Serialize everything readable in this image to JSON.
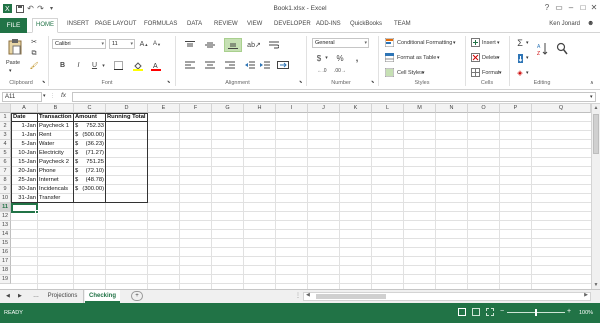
{
  "window": {
    "title": "Book1.xlsx - Excel",
    "user": "Ken Jonard"
  },
  "ribbon_tabs": [
    "FILE",
    "HOME",
    "INSERT",
    "PAGE LAYOUT",
    "FORMULAS",
    "DATA",
    "REVIEW",
    "VIEW",
    "DEVELOPER",
    "ADD-INS",
    "QuickBooks",
    "TEAM"
  ],
  "ribbon": {
    "clipboard": {
      "label": "Clipboard",
      "paste": "Paste"
    },
    "font": {
      "label": "Font",
      "name": "Calibri",
      "size": "11",
      "bold": "B",
      "italic": "I",
      "underline": "U"
    },
    "alignment": {
      "label": "Alignment"
    },
    "number": {
      "label": "Number",
      "format": "General",
      "currency": "$",
      "percent": "%",
      "comma": ","
    },
    "styles": {
      "label": "Styles",
      "cond": "Conditional Formatting",
      "table": "Format as Table",
      "cell": "Cell Styles"
    },
    "cells": {
      "label": "Cells",
      "insert": "Insert",
      "delete": "Delete",
      "format": "Format"
    },
    "editing": {
      "label": "Editing"
    }
  },
  "formula_bar": {
    "name_box": "A11",
    "fx": "fx",
    "value": ""
  },
  "grid": {
    "columns": [
      "A",
      "B",
      "C",
      "D",
      "E",
      "F",
      "G",
      "H",
      "I",
      "J",
      "K",
      "L",
      "M",
      "N",
      "O",
      "P",
      "Q"
    ],
    "rows": [
      "1",
      "2",
      "3",
      "4",
      "5",
      "6",
      "7",
      "8",
      "9",
      "10",
      "11",
      "12",
      "13",
      "14",
      "15",
      "16",
      "17",
      "18",
      "19"
    ],
    "headers": {
      "a": "Date",
      "b": "Transaction",
      "c": "Amount",
      "d": "Running Total"
    },
    "data": [
      {
        "date": "1-Jan",
        "txn": "Paycheck 1",
        "cur": "$",
        "amt": "752.33"
      },
      {
        "date": "1-Jan",
        "txn": "Rent",
        "cur": "$",
        "amt": "(500.00)"
      },
      {
        "date": "5-Jan",
        "txn": "Water",
        "cur": "$",
        "amt": "(36.23)"
      },
      {
        "date": "10-Jan",
        "txn": "Electricity",
        "cur": "$",
        "amt": "(71.27)"
      },
      {
        "date": "15-Jan",
        "txn": "Paycheck 2",
        "cur": "$",
        "amt": "751.25"
      },
      {
        "date": "20-Jan",
        "txn": "Phone",
        "cur": "$",
        "amt": "(72.10)"
      },
      {
        "date": "25-Jan",
        "txn": "Internet",
        "cur": "$",
        "amt": "(48.78)"
      },
      {
        "date": "30-Jan",
        "txn": "Incidencals",
        "cur": "$",
        "amt": "(300.00)"
      },
      {
        "date": "31-Jan",
        "txn": "Transfer",
        "cur": "",
        "amt": ""
      }
    ]
  },
  "sheets": {
    "first": "Projections",
    "second": "Checking",
    "add": "+"
  },
  "status": {
    "left": "READY",
    "zoom": "100%"
  },
  "colors": {
    "accent": "#217346"
  }
}
